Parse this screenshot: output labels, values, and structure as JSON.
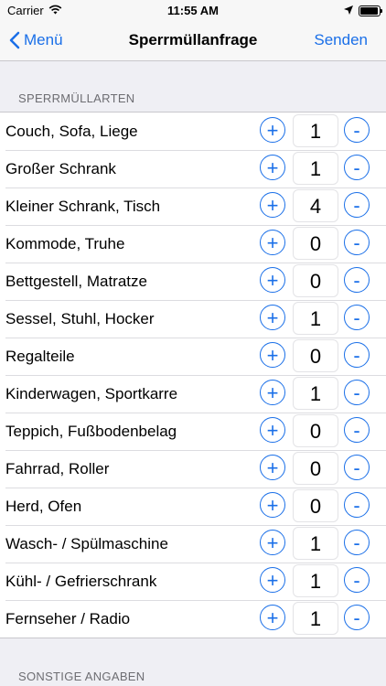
{
  "status_bar": {
    "carrier": "Carrier",
    "time": "11:55 AM",
    "battery_level": 0.95
  },
  "nav": {
    "back_label": "Menü",
    "title": "Sperrmüllanfrage",
    "send_label": "Senden"
  },
  "section_header": "SPERRMÜLLARTEN",
  "items": [
    {
      "label": "Couch, Sofa, Liege",
      "qty": "1"
    },
    {
      "label": "Großer Schrank",
      "qty": "1"
    },
    {
      "label": "Kleiner Schrank, Tisch",
      "qty": "4"
    },
    {
      "label": "Kommode, Truhe",
      "qty": "0"
    },
    {
      "label": "Bettgestell, Matratze",
      "qty": "0"
    },
    {
      "label": "Sessel, Stuhl, Hocker",
      "qty": "1"
    },
    {
      "label": "Regalteile",
      "qty": "0"
    },
    {
      "label": "Kinderwagen, Sportkarre",
      "qty": "1"
    },
    {
      "label": "Teppich, Fußbodenbelag",
      "qty": "0"
    },
    {
      "label": "Fahrrad, Roller",
      "qty": "0"
    },
    {
      "label": "Herd, Ofen",
      "qty": "0"
    },
    {
      "label": "Wasch- / Spülmaschine",
      "qty": "1"
    },
    {
      "label": "Kühl- / Gefrierschrank",
      "qty": "1"
    },
    {
      "label": "Fernseher / Radio",
      "qty": "1"
    }
  ],
  "plus_symbol": "+",
  "minus_symbol": "-",
  "section_header_2": "SONSTIGE ANGABEN",
  "colors": {
    "accent": "#1a6fe8",
    "background": "#efeff4"
  }
}
